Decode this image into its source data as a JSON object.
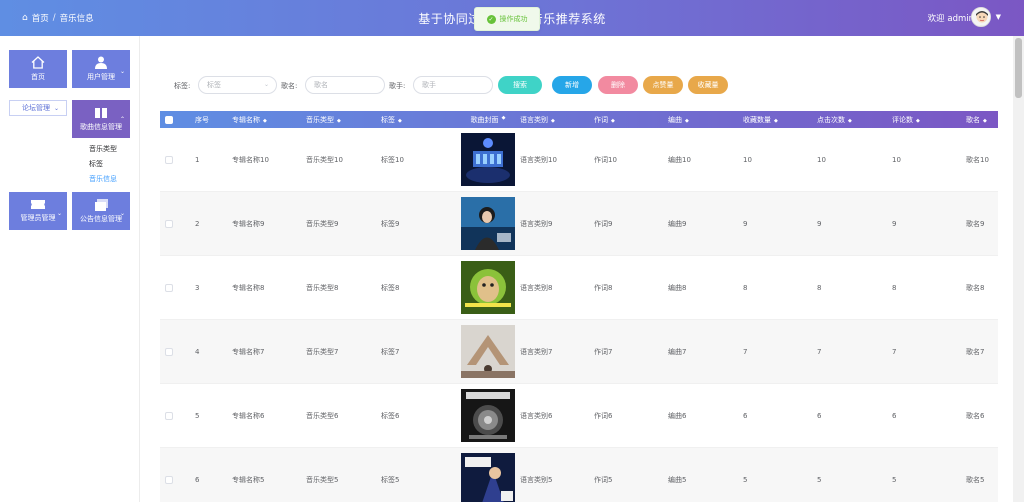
{
  "header": {
    "breadcrumb_home": "首页",
    "breadcrumb_sep": "/",
    "breadcrumb_current": "音乐信息",
    "app_title": "基于协同过滤算法的音乐推荐系统",
    "welcome": "欢迎 admin"
  },
  "toast": {
    "message": "操作成功"
  },
  "sidebar": {
    "home": "首页",
    "user_mgmt": "用户管理",
    "forum_mgmt": "论坛管理",
    "song_mgmt": "歌曲信息管理",
    "submenu": [
      "音乐类型",
      "标签",
      "音乐信息"
    ],
    "admin_mgmt": "管理员管理",
    "notice_mgmt": "公告信息管理"
  },
  "filters": {
    "tag_label": "标签:",
    "tag_placeholder": "标签",
    "song_label": "歌名:",
    "song_placeholder": "歌名",
    "singer_label": "歌手:",
    "singer_placeholder": "歌手"
  },
  "buttons": {
    "search": "搜索",
    "add": "新增",
    "delete": "删除",
    "like_chart": "点赞量",
    "fav_chart": "收藏量"
  },
  "colors": {
    "search": "#3fd3c7",
    "add": "#26a6e8",
    "delete": "#f28aa0",
    "like_chart": "#e8a84a",
    "fav_chart": "#e8a84a"
  },
  "table": {
    "headers": [
      "序号",
      "专辑名称",
      "音乐类型",
      "标签",
      "歌曲封面",
      "语言类别",
      "作词",
      "编曲",
      "收藏数量",
      "点击次数",
      "评论数",
      "歌名"
    ],
    "rows": [
      {
        "idx": "1",
        "album": "专辑名称10",
        "type": "音乐类型10",
        "tag": "标签10",
        "lang": "语言类别10",
        "lyric": "作词10",
        "comp": "编曲10",
        "fav": "10",
        "click": "10",
        "cmt": "10",
        "name": "歌名10"
      },
      {
        "idx": "2",
        "album": "专辑名称9",
        "type": "音乐类型9",
        "tag": "标签9",
        "lang": "语言类别9",
        "lyric": "作词9",
        "comp": "编曲9",
        "fav": "9",
        "click": "9",
        "cmt": "9",
        "name": "歌名9"
      },
      {
        "idx": "3",
        "album": "专辑名称8",
        "type": "音乐类型8",
        "tag": "标签8",
        "lang": "语言类别8",
        "lyric": "作词8",
        "comp": "编曲8",
        "fav": "8",
        "click": "8",
        "cmt": "8",
        "name": "歌名8"
      },
      {
        "idx": "4",
        "album": "专辑名称7",
        "type": "音乐类型7",
        "tag": "标签7",
        "lang": "语言类别7",
        "lyric": "作词7",
        "comp": "编曲7",
        "fav": "7",
        "click": "7",
        "cmt": "7",
        "name": "歌名7"
      },
      {
        "idx": "5",
        "album": "专辑名称6",
        "type": "音乐类型6",
        "tag": "标签6",
        "lang": "语言类别6",
        "lyric": "作词6",
        "comp": "编曲6",
        "fav": "6",
        "click": "6",
        "cmt": "6",
        "name": "歌名6"
      },
      {
        "idx": "6",
        "album": "专辑名称5",
        "type": "音乐类型5",
        "tag": "标签5",
        "lang": "语言类别5",
        "lyric": "作词5",
        "comp": "编曲5",
        "fav": "5",
        "click": "5",
        "cmt": "5",
        "name": "歌名5"
      }
    ]
  }
}
